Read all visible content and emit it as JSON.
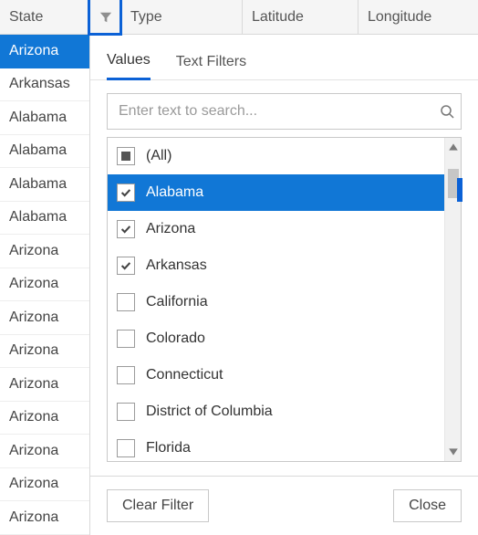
{
  "columns": {
    "state": "State",
    "type": "Type",
    "latitude": "Latitude",
    "longitude": "Longitude"
  },
  "state_rows": [
    {
      "label": "Arizona",
      "selected": true
    },
    {
      "label": "Arkansas"
    },
    {
      "label": "Alabama"
    },
    {
      "label": "Alabama"
    },
    {
      "label": "Alabama"
    },
    {
      "label": "Alabama"
    },
    {
      "label": "Arizona"
    },
    {
      "label": "Arizona"
    },
    {
      "label": "Arizona"
    },
    {
      "label": "Arizona"
    },
    {
      "label": "Arizona"
    },
    {
      "label": "Arizona"
    },
    {
      "label": "Arizona"
    },
    {
      "label": "Arizona"
    },
    {
      "label": "Arizona"
    }
  ],
  "tabs": {
    "values": "Values",
    "text_filters": "Text Filters",
    "active": "values"
  },
  "search": {
    "placeholder": "Enter text to search..."
  },
  "values": {
    "all_label": "(All)",
    "items": [
      {
        "label": "Alabama",
        "checked": true,
        "selected": true
      },
      {
        "label": "Arizona",
        "checked": true
      },
      {
        "label": "Arkansas",
        "checked": true
      },
      {
        "label": "California",
        "checked": false
      },
      {
        "label": "Colorado",
        "checked": false
      },
      {
        "label": "Connecticut",
        "checked": false
      },
      {
        "label": "District of Columbia",
        "checked": false
      },
      {
        "label": "Florida",
        "checked": false
      }
    ]
  },
  "buttons": {
    "clear": "Clear Filter",
    "close": "Close"
  }
}
